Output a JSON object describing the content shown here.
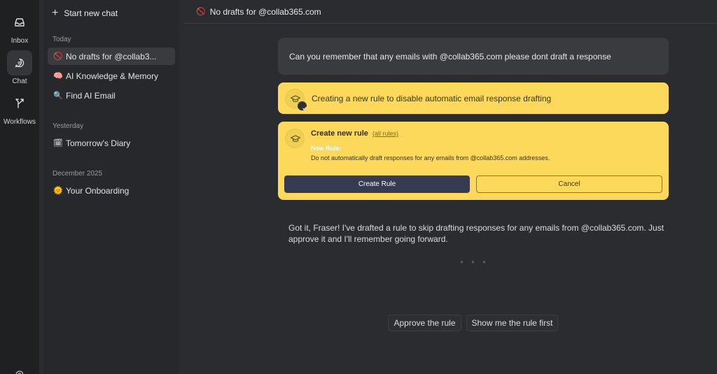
{
  "rail": {
    "items": [
      {
        "label": "Inbox",
        "icon": "inbox-icon"
      },
      {
        "label": "Chat",
        "icon": "chat-icon",
        "active": true
      },
      {
        "label": "Workflows",
        "icon": "workflows-icon"
      }
    ]
  },
  "sidebar": {
    "new_chat_label": "Start new chat",
    "sections": [
      {
        "label": "Today",
        "items": [
          {
            "emoji": "🚫",
            "label": "No drafts for @collab3...",
            "active": true
          },
          {
            "emoji": "🧠",
            "label": "AI Knowledge & Memory"
          },
          {
            "emoji": "🔍",
            "label": "Find AI Email"
          }
        ]
      },
      {
        "label": "Yesterday",
        "items": [
          {
            "emoji": "🗓",
            "label": "Tomorrow's Diary"
          }
        ]
      },
      {
        "label": "December 2025",
        "items": [
          {
            "emoji": "🌞",
            "label": "Your Onboarding"
          }
        ]
      }
    ]
  },
  "topbar": {
    "emoji": "🚫",
    "title": "No drafts for @collab365.com"
  },
  "conversation": {
    "user_message": "Can you remember that any emails with @collab365.com please dont draft a response",
    "status_text": "Creating a new rule to disable automatic email response drafting",
    "rule_card": {
      "title": "Create new rule",
      "all_rules_link": "(all rules)",
      "rule_label": "New Rule:",
      "rule_description": "Do not automatically draft responses for any emails from @collab365.com addresses.",
      "create_button": "Create Rule",
      "cancel_button": "Cancel"
    },
    "assistant_message": "Got it, Fraser! I've drafted a rule to skip drafting responses for any emails from @collab365.com. Just approve it and I'll remember going forward.",
    "loading_dots": "* * *"
  },
  "suggestions": [
    "Approve the rule",
    "Show me the rule first"
  ],
  "colors": {
    "accent_yellow": "#fcd95a",
    "button_dark": "#363b52",
    "background": "#2b2c2f"
  }
}
